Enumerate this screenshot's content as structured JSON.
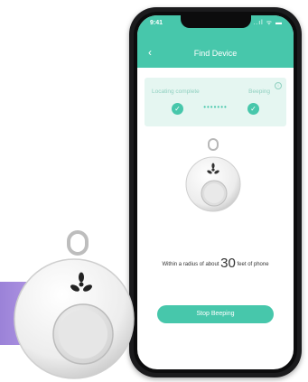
{
  "status_bar": {
    "time": "9:41",
    "icons": "..ıl ᯤ ▬"
  },
  "header": {
    "back_symbol": "‹",
    "title": "Find Device"
  },
  "status_card": {
    "left_label": "Locating complete",
    "right_label": "Beeping",
    "info_symbol": "i",
    "check_symbol": "✓",
    "dots": "•••••••"
  },
  "distance": {
    "prefix": "Within a radius of about",
    "value": "30",
    "suffix": "feet of phone"
  },
  "action": {
    "stop_label": "Stop Beeping"
  },
  "colors": {
    "accent": "#47c7ab",
    "card_bg": "#e5f6f1",
    "purple": "#a98fe0"
  },
  "icons": [
    "back-chevron-icon",
    "info-icon",
    "check-icon",
    "fan-logo-icon",
    "signal-icon",
    "wifi-icon",
    "battery-icon"
  ]
}
